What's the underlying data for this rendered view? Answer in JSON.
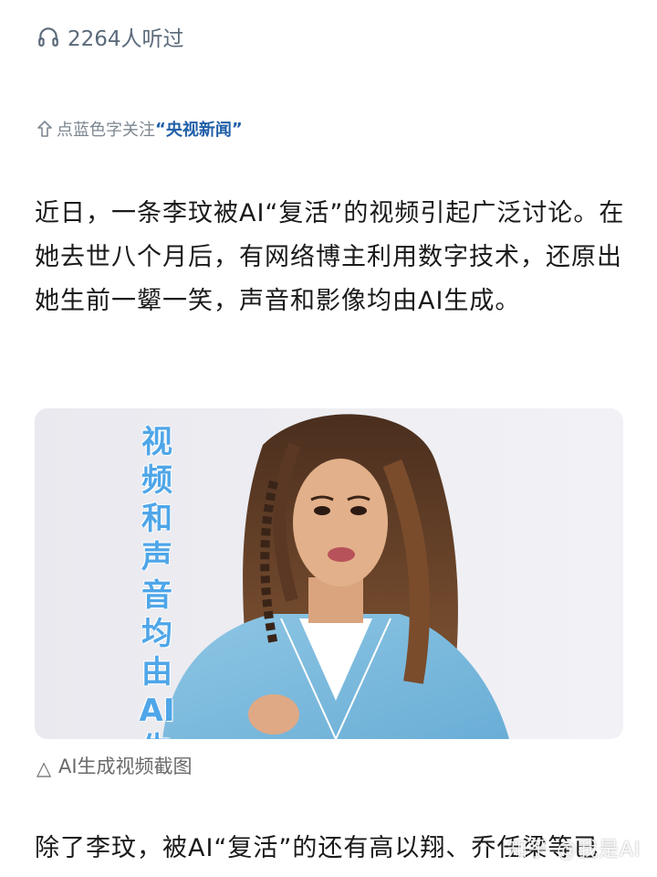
{
  "listen": {
    "count_text": "2264人听过",
    "icon": "headphones-icon"
  },
  "follow": {
    "prefix": "点蓝色字关注",
    "quote_open": "“",
    "account": "央视新闻",
    "quote_close": "”",
    "icon": "up-arrow-icon"
  },
  "article": {
    "paragraph1": "近日，一条李玟被AI“复活”的视频引起广泛讨论。在她去世八个月后，有网络博主利用数字技术，还原出她生前一颦一笑，声音和影像均由AI生成。",
    "paragraph2": "除了李玟，被AI“复活”的还有高以翔、乔任梁等已"
  },
  "video": {
    "overlay_text": "视频和声音均由AI生成",
    "overlay_color": "#5aa9e6",
    "caption_symbol": "△",
    "caption": "AI生成视频截图"
  },
  "watermark": "知乎 @我是AI",
  "colors": {
    "accent": "#1f5fa8",
    "text": "#1a1a1a",
    "muted": "#7d8790"
  }
}
